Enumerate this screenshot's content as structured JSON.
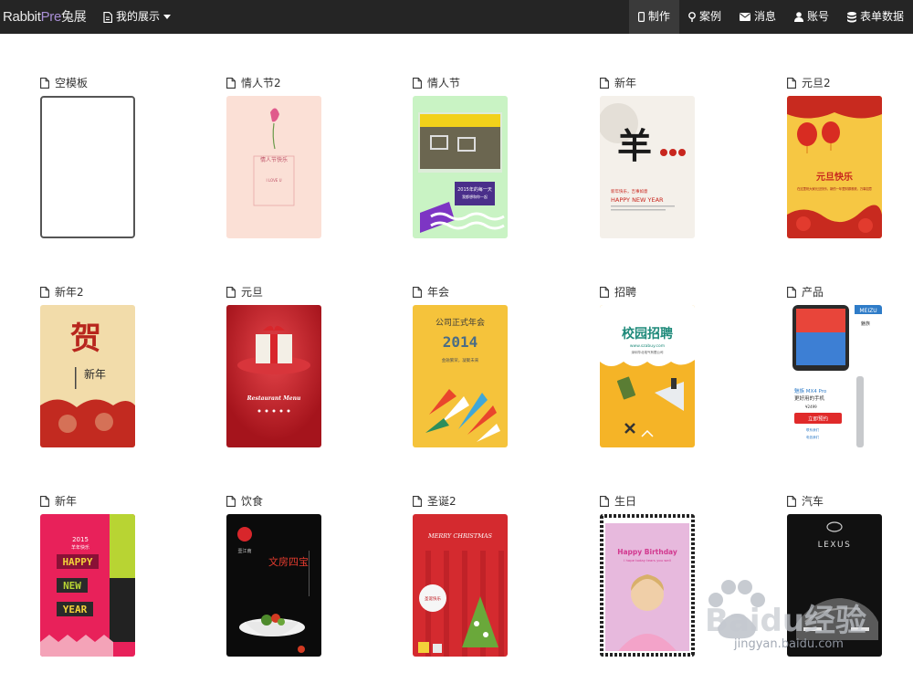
{
  "brand": {
    "part1": "Rabbit",
    "part2": "Pre",
    "part3": "兔展"
  },
  "my_menu": {
    "label": "我的展示",
    "icon": "document-icon"
  },
  "nav": [
    {
      "label": "制作",
      "icon": "mobile-icon",
      "active": true
    },
    {
      "label": "案例",
      "icon": "map-pin-icon",
      "active": false
    },
    {
      "label": "消息",
      "icon": "envelope-icon",
      "active": false
    },
    {
      "label": "账号",
      "icon": "user-icon",
      "active": false
    },
    {
      "label": "表单数据",
      "icon": "database-icon",
      "active": false
    }
  ],
  "templates": [
    {
      "title": "空模板"
    },
    {
      "title": "情人节2",
      "inner": "情人节快乐",
      "inner2": "I LOVE U"
    },
    {
      "title": "情人节",
      "inner": "2015年的每一天",
      "inner2": "我都想和你一起"
    },
    {
      "title": "新年",
      "inner": "羊",
      "inner2": "HAPPY NEW YEAR",
      "inner3": "新年快乐，吉事如意"
    },
    {
      "title": "元旦2",
      "inner": "元旦快乐",
      "inner2": "在这里祝大家元旦快乐，新的一年里财源滚滚，万事如意"
    },
    {
      "title": "新年2",
      "inner": "贺",
      "inner2": "新年"
    },
    {
      "title": "元旦",
      "inner": "Restaurant Menu"
    },
    {
      "title": "年会",
      "inner": "公司正式年会",
      "inner2": "2014",
      "inner3": "金融繁荣，凝聚未来"
    },
    {
      "title": "招聘",
      "inner": "校园招聘",
      "inner2": "www.szabuy.com",
      "inner3": "深圳华北电气有限公司"
    },
    {
      "title": "产品",
      "inner": "MEIZU",
      "inner2": "魅族 MX4 Pro",
      "inner3": "更好用的手机",
      "inner4": "¥2499",
      "inner5": "立即预约",
      "inner6": "魅族",
      "inner7": "联系我们",
      "inner8": "电信我们"
    },
    {
      "title": "新年",
      "inner": "2015",
      "inner2": "羊年快乐",
      "inner3": "HAPPY",
      "inner4": "NEW",
      "inner5": "YEAR"
    },
    {
      "title": "饮食",
      "inner": "文房四宝",
      "inner2": "壹江南"
    },
    {
      "title": "圣诞2",
      "inner": "MERRY CHRISTMAS",
      "inner2": "圣诞快乐"
    },
    {
      "title": "生日",
      "inner": "Happy Birthday",
      "inner2": "I hope today tears you well"
    },
    {
      "title": "汽车",
      "inner": "LEXUS"
    }
  ],
  "watermark": {
    "text": "Baidu经验",
    "url": "jingyan.baidu.com"
  },
  "colors": {
    "topbar": "#252525",
    "active_nav": "#3a3a3a",
    "brand_accent": "#a98fd6"
  }
}
